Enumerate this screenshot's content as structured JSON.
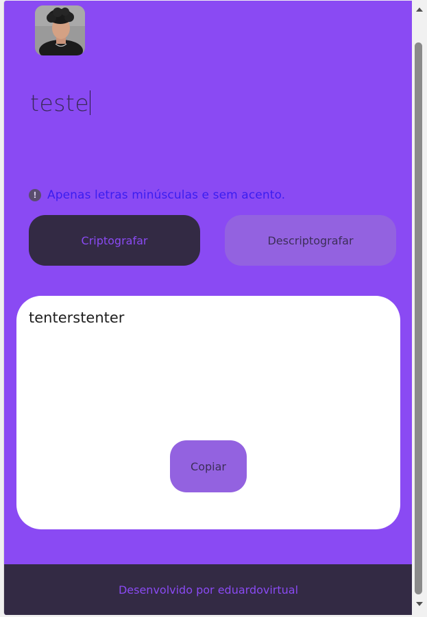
{
  "input": {
    "value": "teste"
  },
  "hint": {
    "icon": "exclamation-circle-icon",
    "text": "Apenas letras minúsculas e sem acento."
  },
  "buttons": {
    "encrypt_label": "Criptografar",
    "decrypt_label": "Descriptografar",
    "copy_label": "Copiar"
  },
  "output": {
    "text": "tenterstenter"
  },
  "footer": {
    "text": "Desenvolvido por eduardovirtual"
  },
  "colors": {
    "background": "#8a4af3",
    "dark": "#332a44",
    "secondary_button": "#9362e0",
    "hint_text": "#3b1df0",
    "card": "#ffffff"
  }
}
